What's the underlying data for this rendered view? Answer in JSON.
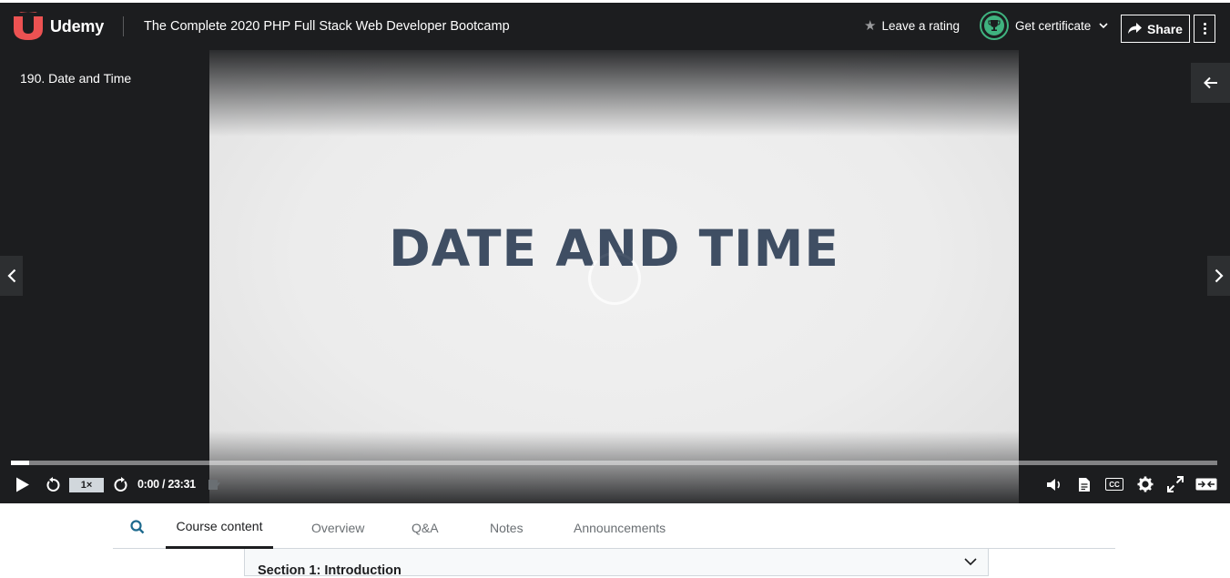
{
  "header": {
    "brand": "Udemy",
    "course_title": "The Complete 2020 PHP Full Stack Web Developer Bootcamp",
    "rating_label": "Leave a rating",
    "certificate_label": "Get certificate",
    "share_label": "Share",
    "accent_color": "#a435f0",
    "logo_color": "#ec5252",
    "certificate_color": "#3fb27f"
  },
  "player": {
    "lecture_title": "190. Date and Time",
    "video_title_text": "DATE AND TIME",
    "speed": "1×",
    "time_display": "0:00 / 23:31",
    "progress_fraction": 0.015
  },
  "tabs": {
    "course_content": "Course content",
    "overview": "Overview",
    "qa": "Q&A",
    "notes": "Notes",
    "announcements": "Announcements",
    "active": "Course content"
  },
  "sidebar_section": {
    "title": "Section 1: Introduction"
  }
}
